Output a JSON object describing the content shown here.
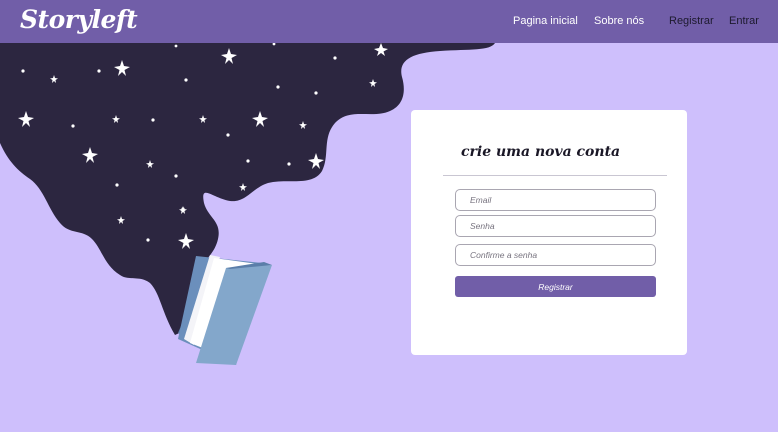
{
  "nav": {
    "logo": "Storyleft",
    "links": {
      "home": "Pagina inicial",
      "about": "Sobre nós",
      "register": "Registrar",
      "login": "Entrar"
    }
  },
  "form": {
    "title": "crie uma nova conta",
    "email_placeholder": "Email",
    "password_placeholder": "Senha",
    "confirm_placeholder": "Confirme a senha",
    "submit_label": "Registrar"
  },
  "colors": {
    "background": "#cebffc",
    "navbar": "#715ea8",
    "night_sky": "#2c2640",
    "book_cover": "#7fa6c9",
    "button": "#715ea8"
  }
}
